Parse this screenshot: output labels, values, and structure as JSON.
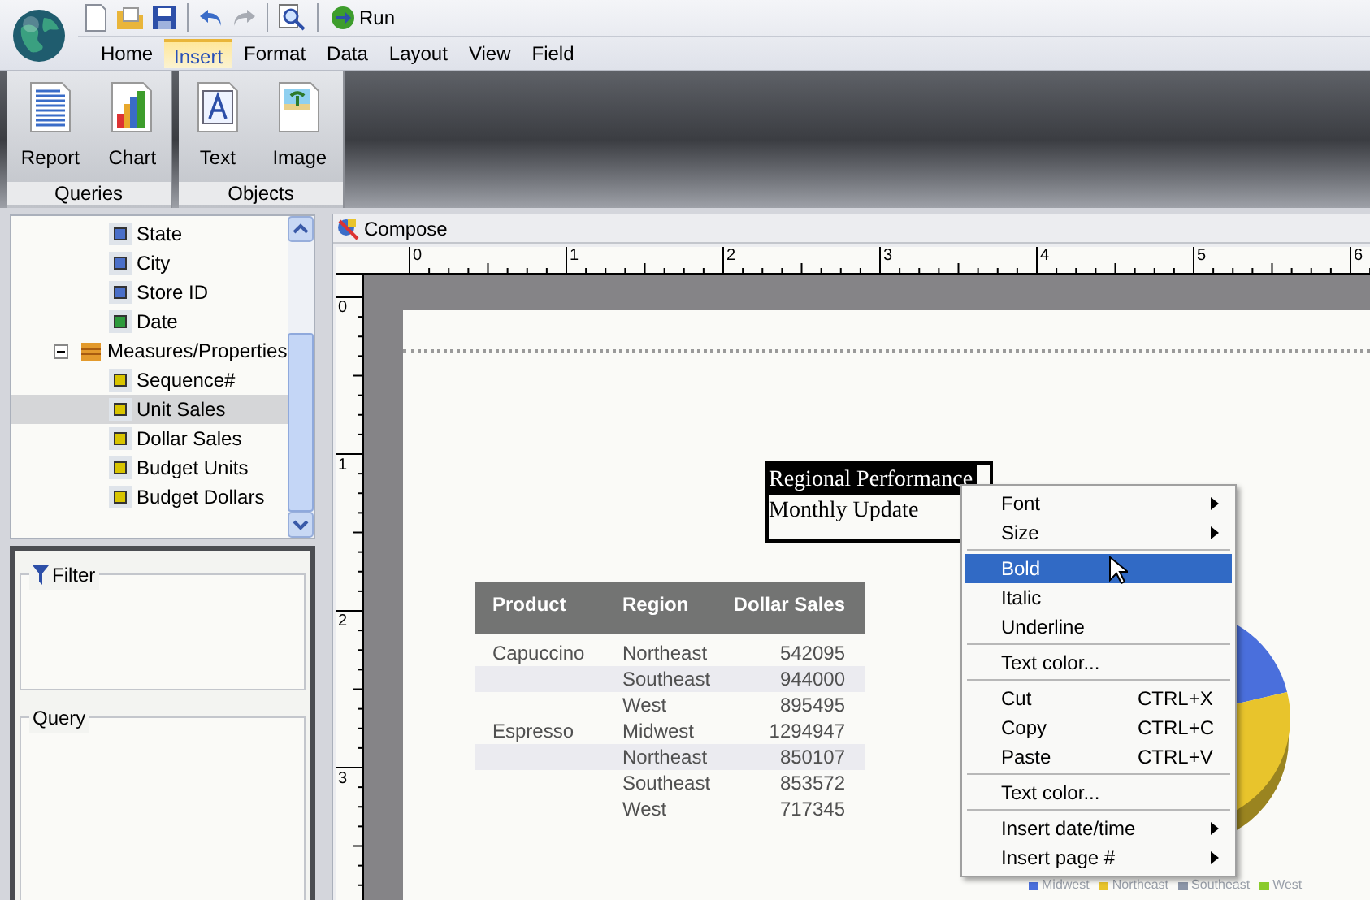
{
  "toolbar": {
    "run_label": "Run"
  },
  "menu_tabs": [
    {
      "label": "Home",
      "selected": false
    },
    {
      "label": "Insert",
      "selected": true
    },
    {
      "label": "Format",
      "selected": false
    },
    {
      "label": "Data",
      "selected": false
    },
    {
      "label": "Layout",
      "selected": false
    },
    {
      "label": "View",
      "selected": false
    },
    {
      "label": "Field",
      "selected": false
    }
  ],
  "ribbon_groups": [
    {
      "label": "Queries",
      "items": [
        {
          "label": "Report",
          "kind": "report"
        },
        {
          "label": "Chart",
          "kind": "chart"
        }
      ]
    },
    {
      "label": "Objects",
      "items": [
        {
          "label": "Text",
          "kind": "text"
        },
        {
          "label": "Image",
          "kind": "image"
        }
      ]
    }
  ],
  "tree": [
    {
      "label": "State",
      "kind": "dimension",
      "selected": false
    },
    {
      "label": "City",
      "kind": "dimension",
      "selected": false
    },
    {
      "label": "Store ID",
      "kind": "dimension",
      "selected": false
    },
    {
      "label": "Date",
      "kind": "date",
      "selected": false
    },
    {
      "label": "Measures/Properties",
      "kind": "folder",
      "expanded": true,
      "selected": false,
      "children": [
        {
          "label": "Sequence#",
          "kind": "measure",
          "selected": false
        },
        {
          "label": "Unit Sales",
          "kind": "measure",
          "selected": true
        },
        {
          "label": "Dollar Sales",
          "kind": "measure",
          "selected": false
        },
        {
          "label": "Budget Units",
          "kind": "measure",
          "selected": false
        },
        {
          "label": "Budget Dollars",
          "kind": "measure",
          "selected": false
        }
      ]
    }
  ],
  "filter_panel": {
    "title": "Filter"
  },
  "query_panel": {
    "title": "Query"
  },
  "compose": {
    "title": "Compose",
    "ruler_h": [
      "0",
      "1",
      "2",
      "3",
      "4",
      "5",
      "6"
    ],
    "ruler_v": [
      "0",
      "1",
      "2",
      "3"
    ]
  },
  "text_box": {
    "lines": [
      {
        "text": "Regional Performance",
        "selected": true
      },
      {
        "text": "Monthly Update",
        "selected": false
      }
    ]
  },
  "table": {
    "columns": [
      "Product",
      "Region",
      "Dollar Sales"
    ],
    "rows": [
      [
        "Capuccino",
        "Northeast",
        "542095"
      ],
      [
        "",
        "Southeast",
        "944000"
      ],
      [
        "",
        "West",
        "895495"
      ],
      [
        "Espresso",
        "Midwest",
        "1294947"
      ],
      [
        "",
        "Northeast",
        "850107"
      ],
      [
        "",
        "Southeast",
        "853572"
      ],
      [
        "",
        "West",
        "717345"
      ]
    ]
  },
  "pie_legend": [
    {
      "label": "Midwest",
      "color": "#4a6fdc"
    },
    {
      "label": "Northeast",
      "color": "#e8c42c"
    },
    {
      "label": "Southeast",
      "color": "#8c96a8"
    },
    {
      "label": "West",
      "color": "#8acb2c"
    }
  ],
  "context_menu": [
    {
      "label": "Font",
      "submenu": true,
      "selected": false
    },
    {
      "label": "Size",
      "submenu": true,
      "selected": false
    },
    {
      "kind": "separator"
    },
    {
      "label": "Bold",
      "selected": true
    },
    {
      "label": "Italic",
      "selected": false
    },
    {
      "label": "Underline",
      "selected": false
    },
    {
      "kind": "separator"
    },
    {
      "label": "Text color...",
      "selected": false
    },
    {
      "kind": "separator"
    },
    {
      "label": "Cut",
      "shortcut": "CTRL+X",
      "selected": false
    },
    {
      "label": "Copy",
      "shortcut": "CTRL+C",
      "selected": false
    },
    {
      "label": "Paste",
      "shortcut": "CTRL+V",
      "selected": false
    },
    {
      "kind": "separator"
    },
    {
      "label": "Text color...",
      "selected": false
    },
    {
      "kind": "separator"
    },
    {
      "label": "Insert date/time",
      "submenu": true,
      "selected": false
    },
    {
      "label": "Insert page #",
      "submenu": true,
      "selected": false
    }
  ]
}
